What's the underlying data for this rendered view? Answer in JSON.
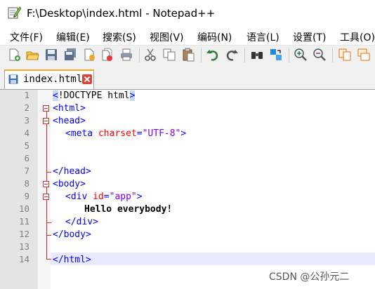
{
  "window": {
    "title": "F:\\Desktop\\index.html - Notepad++"
  },
  "menu": {
    "items": [
      "文件(F)",
      "编辑(E)",
      "搜索(S)",
      "视图(V)",
      "编码(N)",
      "语言(L)",
      "设置(T)",
      "工具(O)"
    ]
  },
  "toolbar": {
    "icons": [
      "new-file-icon",
      "open-file-icon",
      "save-icon",
      "save-all-icon",
      "close-icon",
      "close-all-icon",
      "print-icon",
      "cut-icon",
      "copy-icon",
      "paste-icon",
      "undo-icon",
      "redo-icon",
      "find-icon",
      "replace-icon",
      "zoom-in-icon",
      "zoom-out-icon",
      "sync-vertical-icon",
      "sync-horizontal-icon"
    ]
  },
  "tab": {
    "label": "index.html"
  },
  "editor": {
    "line_numbers": [
      "1",
      "2",
      "3",
      "4",
      "5",
      "6",
      "7",
      "8",
      "9",
      "10",
      "11",
      "12",
      "13",
      "14"
    ],
    "lines": {
      "l1_lt": "<",
      "l1_doctype": "!DOCTYPE html",
      "l1_gt": ">",
      "l2": "<html>",
      "l3": "<head>",
      "l4_open": "<meta ",
      "l4_attr": "charset",
      "l4_eq": "=",
      "l4_val": "\"UTF-8\"",
      "l4_close": ">",
      "l7": "</head>",
      "l8": "<body>",
      "l9_open": "<div ",
      "l9_attr": "id",
      "l9_eq": "=",
      "l9_val": "\"app\"",
      "l9_close": ">",
      "l10": "Hello everybody!",
      "l11": "</div>",
      "l12": "</body>",
      "l14": "</html>"
    }
  },
  "watermark": "CSDN @公孙元二",
  "colors": {
    "tag": "#0000ff",
    "attribute": "#ff0000",
    "value": "#8000ff",
    "fold_marker": "#d32f2f",
    "current_line": "#e8e8ff"
  }
}
